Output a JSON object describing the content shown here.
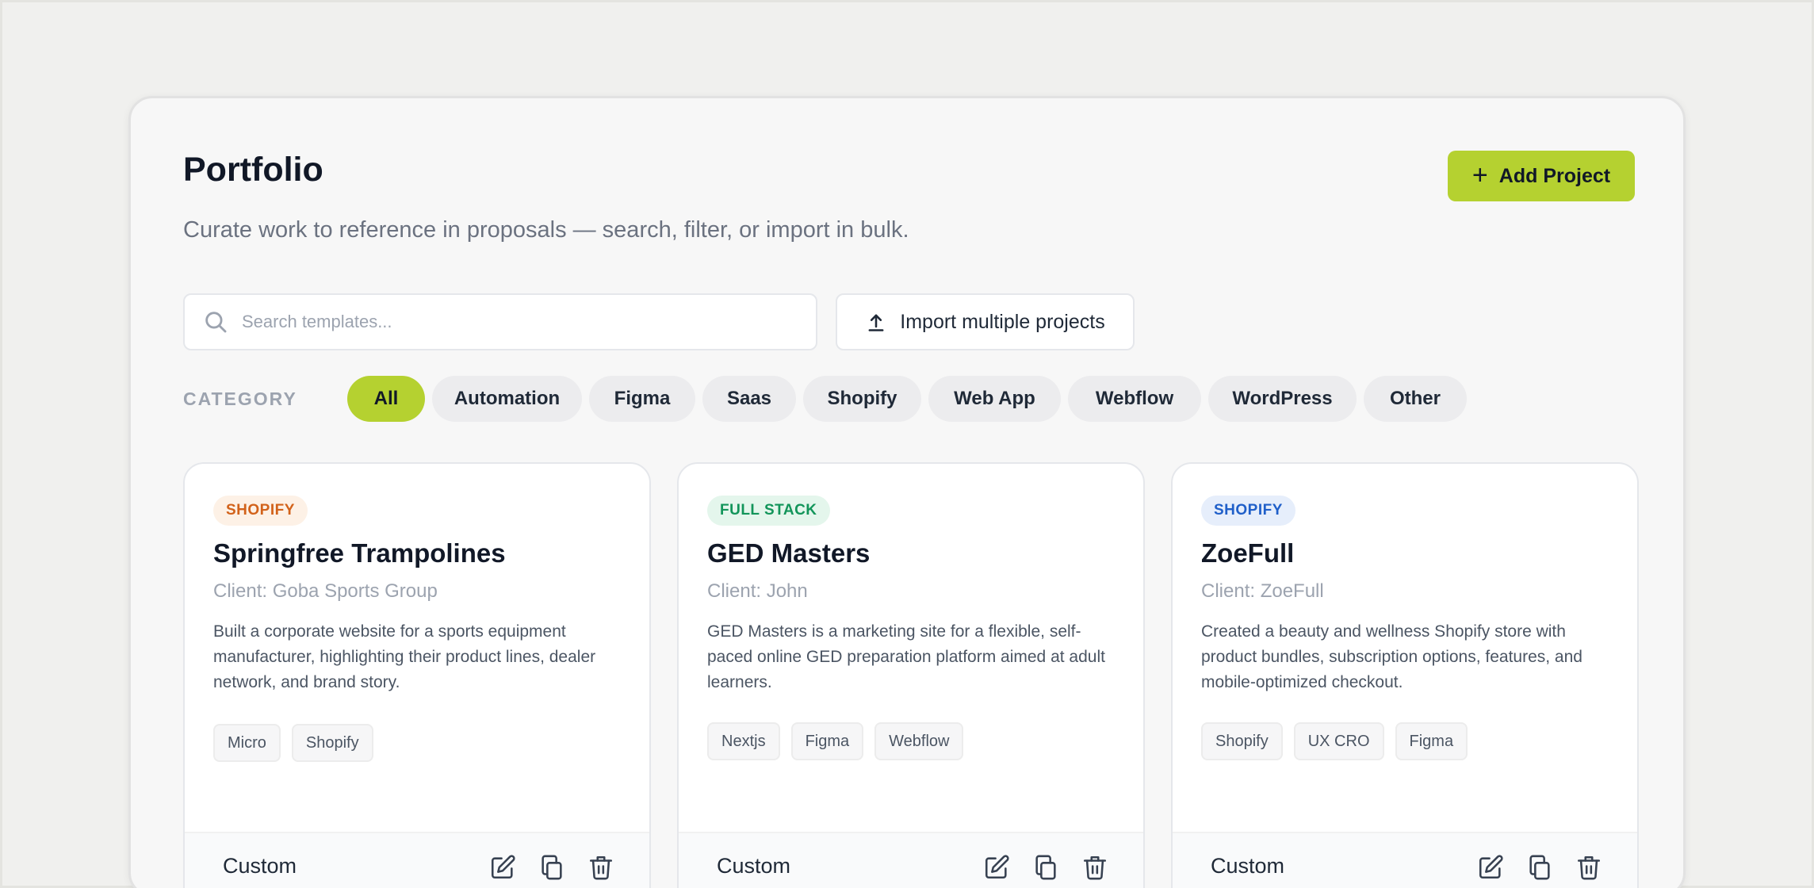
{
  "header": {
    "title": "Portfolio",
    "subtitle": "Curate work to reference in proposals — search, filter, or import in bulk.",
    "add_label": "Add Project"
  },
  "toolbar": {
    "search_placeholder": "Search templates...",
    "import_label": "Import multiple projects"
  },
  "filters": {
    "label": "CATEGORY",
    "active": "All",
    "items": [
      "All",
      "Automation",
      "Figma",
      "Saas",
      "Shopify",
      "Web App",
      "Webflow",
      "WordPress",
      "Other"
    ]
  },
  "colors": {
    "accent": "#b5d130",
    "badge_orange_bg": "#fdf1e6",
    "badge_orange_fg": "#d2621a",
    "badge_green_bg": "#e4f6ec",
    "badge_green_fg": "#12955a",
    "badge_blue_bg": "#e6eefb",
    "badge_blue_fg": "#1f5fc9"
  },
  "cards": [
    {
      "badge": "SHOPIFY",
      "badge_color": "orange",
      "title": "Springfree Trampolines",
      "client": "Client: Goba Sports Group",
      "description": "Built a corporate website for a sports equipment manufacturer, highlighting their product lines, dealer network, and brand story.",
      "tags": [
        "Micro",
        "Shopify"
      ],
      "footer_label": "Custom",
      "actions": [
        "edit-icon",
        "copy-icon",
        "trash-icon"
      ]
    },
    {
      "badge": "FULL STACK",
      "badge_color": "green",
      "title": "GED Masters",
      "client": "Client: John",
      "description": "GED Masters is a marketing site for a flexible, self-paced online GED preparation platform aimed at adult learners.",
      "tags": [
        "Nextjs",
        "Figma",
        "Webflow"
      ],
      "footer_label": "Custom",
      "actions": [
        "edit-icon",
        "copy-icon",
        "trash-icon"
      ]
    },
    {
      "badge": "SHOPIFY",
      "badge_color": "blue",
      "title": "ZoeFull",
      "client": "Client: ZoeFull",
      "description": "Created a beauty and wellness Shopify store with product bundles, subscription options, features, and mobile-optimized checkout.",
      "tags": [
        "Shopify",
        "UX CRO",
        "Figma"
      ],
      "footer_label": "Custom",
      "actions": [
        "edit-icon",
        "copy-icon",
        "trash-icon"
      ]
    }
  ]
}
